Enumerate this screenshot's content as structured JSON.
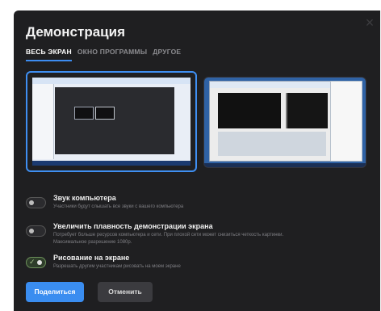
{
  "dialog": {
    "title": "Демонстрация",
    "close_glyph": "×",
    "tabs": [
      {
        "label": "ВЕСЬ ЭКРАН",
        "active": true
      },
      {
        "label": "ОКНО ПРОГРАММЫ",
        "active": false
      },
      {
        "label": "ДРУГОЕ",
        "active": false
      }
    ],
    "options": [
      {
        "title": "Звук компьютера",
        "description": "Участники будут слышать все звуки с вашего компьютера",
        "enabled": false
      },
      {
        "title": "Увеличить плавность демонстрации экрана",
        "description": "Потребует больше ресурсов компьютера и сети. При плохой сети может снизиться четкость картинки.",
        "description2": "Максимальное разрешение 1080р.",
        "enabled": false
      },
      {
        "title": "Рисование на экране",
        "description": "Разрешать другим участникам рисовать на моем экране",
        "enabled": true
      }
    ],
    "buttons": {
      "share": "Поделиться",
      "cancel": "Отменить"
    },
    "colors": {
      "accent": "#3a8df0",
      "background": "#1f1f21"
    }
  }
}
